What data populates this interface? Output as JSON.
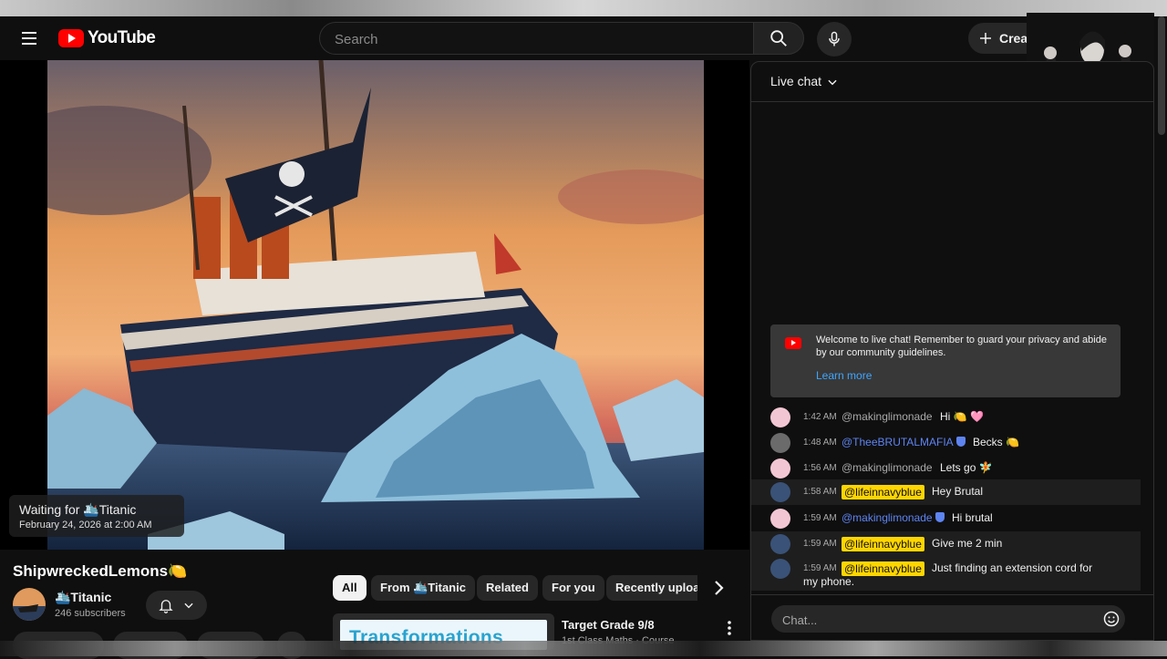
{
  "header": {
    "logo_text": "YouTube",
    "search_placeholder": "Search",
    "create_label": "Creat"
  },
  "player": {
    "status_line1_prefix": "Waiting for ",
    "status_channel": "🛳️Titanic",
    "status_line2": "February 24, 2026 at 2:00 AM"
  },
  "video": {
    "title": "ShipwreckedLemons🍋",
    "channel_name": "🛳️Titanic",
    "subscribers": "246 subscribers"
  },
  "chips": [
    {
      "label": "All",
      "active": true
    },
    {
      "label": "From 🛳️Titanic",
      "active": false
    },
    {
      "label": "Related",
      "active": false
    },
    {
      "label": "For you",
      "active": false
    },
    {
      "label": "Recently uploaded",
      "active": false
    }
  ],
  "recommendation": {
    "thumb_text": "Transformations",
    "title": "Target Grade 9/8",
    "meta": "1st Class Maths · Course"
  },
  "chat": {
    "header": "Live chat",
    "welcome_text": "Welcome to live chat! Remember to guard your privacy and abide by our community guidelines.",
    "learn_more": "Learn more",
    "input_placeholder": "Chat...",
    "messages": [
      {
        "time": "1:42 AM",
        "author": "@makinglimonade",
        "text": "Hi 🍋 🩷",
        "author_style": "normal",
        "highlight": false
      },
      {
        "time": "1:48 AM",
        "author": "@TheeBRUTALMAFIA",
        "text": "Becks 🍋",
        "author_style": "mod",
        "highlight": false
      },
      {
        "time": "1:56 AM",
        "author": "@makinglimonade",
        "text": "Lets go 🧚",
        "author_style": "normal",
        "highlight": false
      },
      {
        "time": "1:58 AM",
        "author": "@lifeinnavyblue",
        "text": "Hey Brutal",
        "author_style": "member",
        "highlight": true
      },
      {
        "time": "1:59 AM",
        "author": "@makinglimonade",
        "text": "Hi brutal",
        "author_style": "mod",
        "highlight": false
      },
      {
        "time": "1:59 AM",
        "author": "@lifeinnavyblue",
        "text": "Give me 2 min",
        "author_style": "member",
        "highlight": true
      },
      {
        "time": "1:59 AM",
        "author": "@lifeinnavyblue",
        "text": "Just finding an extension cord for my phone.",
        "author_style": "member",
        "highlight": true
      }
    ]
  },
  "colors": {
    "brand_red": "#ff0000",
    "link_blue": "#3ea6ff",
    "mod_blue": "#5e84f1",
    "member_yellow": "#ffd600"
  }
}
